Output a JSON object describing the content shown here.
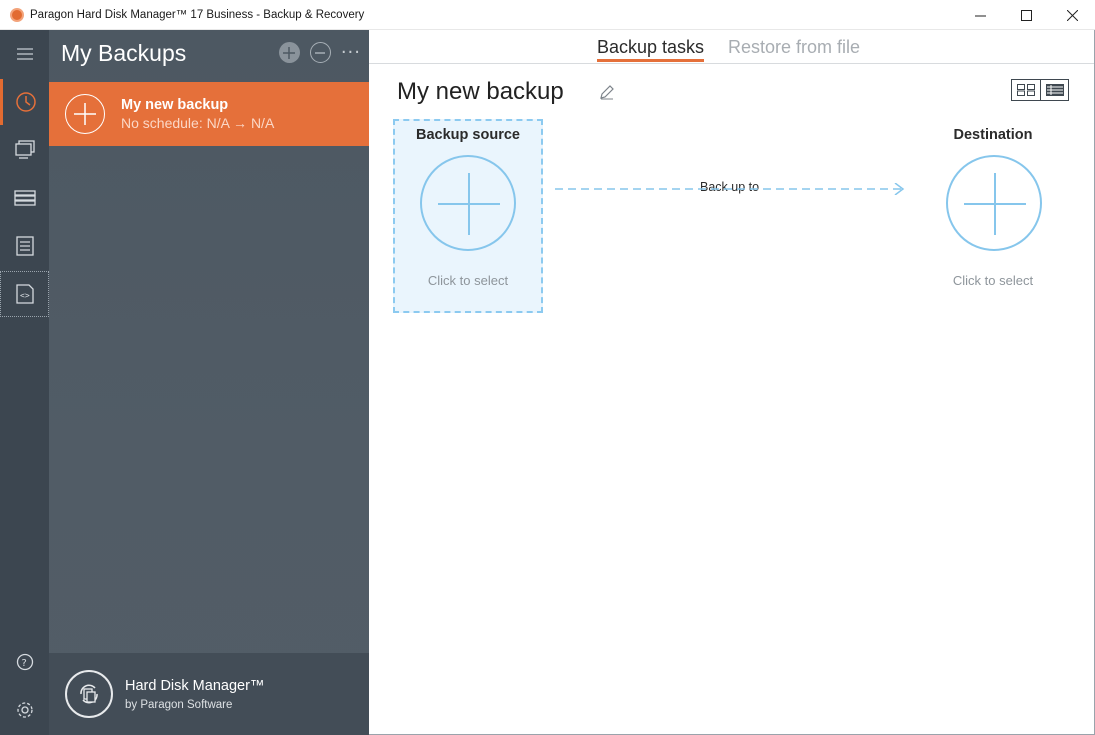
{
  "window": {
    "title": "Paragon Hard Disk Manager™ 17 Business - Backup & Recovery",
    "controls": [
      "minimize",
      "maximize",
      "close"
    ]
  },
  "rail": {
    "items": [
      {
        "icon": "menu-icon"
      },
      {
        "icon": "backup-clock-icon",
        "active": true
      },
      {
        "icon": "disk-copy-icon"
      },
      {
        "icon": "partition-icon"
      },
      {
        "icon": "log-icon"
      },
      {
        "icon": "script-icon"
      },
      {
        "icon": "help-icon"
      },
      {
        "icon": "settings-icon"
      }
    ]
  },
  "panel": {
    "title": "My Backups",
    "add_tooltip": "+",
    "remove_tooltip": "−",
    "more_label": "···",
    "backups": [
      {
        "name": "My new backup",
        "schedule": "No schedule: N/A → N/A"
      }
    ],
    "footer": {
      "product": "Hard Disk Manager™",
      "vendor": "by Paragon Software"
    }
  },
  "main": {
    "tabs": [
      {
        "label": "Backup tasks",
        "active": true
      },
      {
        "label": "Restore from file",
        "active": false
      }
    ],
    "task_title": "My new backup",
    "source": {
      "label": "Backup source",
      "hint": "Click to select"
    },
    "arrow_label": "Back up to",
    "destination": {
      "label": "Destination",
      "hint": "Click to select"
    }
  },
  "colors": {
    "accent": "#e5703a",
    "rail": "#3c4650",
    "panel": "#4d5862",
    "link_blue": "#86c6ec"
  }
}
